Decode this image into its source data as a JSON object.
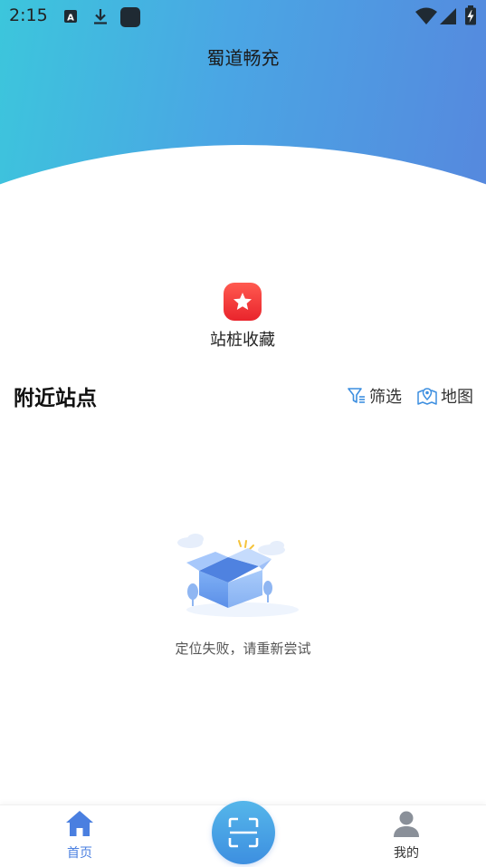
{
  "status_bar": {
    "time": "2:15",
    "icons": [
      "text-notification-icon",
      "download-icon",
      "app-notification-icon",
      "wifi-icon",
      "cell-signal-icon",
      "battery-charging-icon"
    ]
  },
  "header": {
    "title": "蜀道畅充"
  },
  "shortcut": {
    "label": "站桩收藏",
    "icon": "star-icon"
  },
  "nearby": {
    "title": "附近站点",
    "filter_label": "筛选",
    "map_label": "地图"
  },
  "empty_state": {
    "message": "定位失败，请重新尝试"
  },
  "tabbar": {
    "home_label": "首页",
    "mine_label": "我的",
    "scan_icon": "scan-icon"
  },
  "colors": {
    "accent": "#4a7fe0",
    "header_start": "#3cc6dc",
    "header_end": "#5688de",
    "fav_red": "#ef3a35",
    "inactive": "#8a9099"
  }
}
